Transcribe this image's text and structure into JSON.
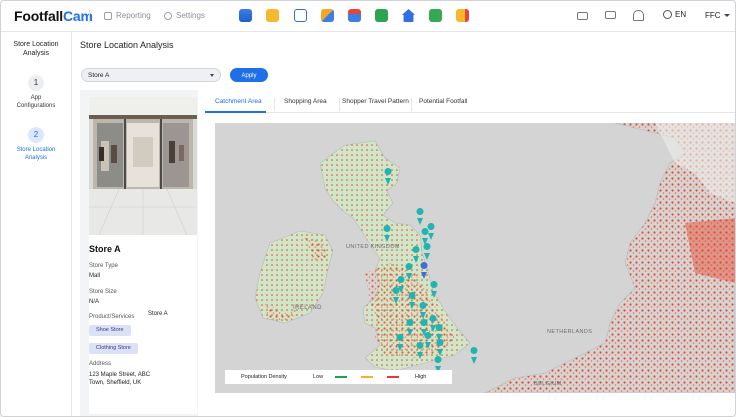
{
  "app": {
    "logo_main": "Footfall",
    "logo_accent": "Cam"
  },
  "topbar": {
    "reporting": "Reporting",
    "settings": "Settings",
    "language": "EN",
    "user": "FFC"
  },
  "sidebar": {
    "title_line1": "Store Location",
    "title_line2": "Analysis",
    "steps": [
      {
        "num": "1",
        "label_line1": "App",
        "label_line2": "Configurations"
      },
      {
        "num": "2",
        "label_line1": "Store Location",
        "label_line2": "Analysis"
      }
    ]
  },
  "main": {
    "title": "Store Location Analysis",
    "store_select": "Store A",
    "apply_label": "Apply"
  },
  "store": {
    "name": "Store A",
    "type_label": "Store Type",
    "type_value": "Mall",
    "size_label": "Store Size",
    "size_value": "N/A",
    "products_label": "Product/Services",
    "products_side": "Store A",
    "tags": [
      "Shoe Store",
      "Clothing Store"
    ],
    "address_label": "Address",
    "address_line1": "123 Maple Street, ABC",
    "address_line2": "Town, Sheffield, UK"
  },
  "tabs": [
    "Catchment Area",
    "Shopping Area",
    "Shopper Travel Pattern",
    "Potential Footfall"
  ],
  "map": {
    "labels": {
      "uk": "UNITED KINGDOM",
      "ireland": "IRELAND",
      "netherlands": "NETHERLANDS",
      "belgium": "BELGIUM"
    },
    "legend": {
      "title": "Population Density",
      "low": "Low",
      "high": "High"
    },
    "colors": {
      "low": "#1aa34a",
      "mid": "#f0b429",
      "high": "#e63a2e",
      "pin": "#1fb5b0",
      "pin_selected": "#3d6fd9",
      "accent": "#1e6fe8"
    }
  }
}
